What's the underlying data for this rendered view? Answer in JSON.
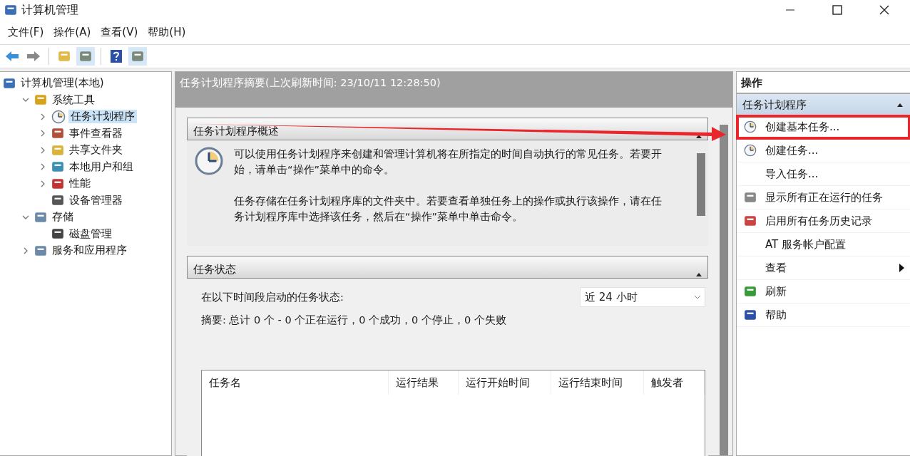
{
  "window": {
    "title": "计算机管理"
  },
  "menu": [
    "文件(F)",
    "操作(A)",
    "查看(V)",
    "帮助(H)"
  ],
  "tree": [
    {
      "label": "计算机管理(本地)",
      "selected": false,
      "children": [
        {
          "label": "系统工具",
          "selected": false,
          "expanded": true,
          "children": [
            {
              "label": "任务计划程序",
              "selected": true,
              "expanded": false
            },
            {
              "label": "事件查看器",
              "selected": false,
              "expanded": false
            },
            {
              "label": "共享文件夹",
              "selected": false,
              "expanded": false
            },
            {
              "label": "本地用户和组",
              "selected": false,
              "expanded": false
            },
            {
              "label": "性能",
              "selected": false,
              "expanded": false
            },
            {
              "label": "设备管理器",
              "selected": false
            }
          ]
        },
        {
          "label": "存储",
          "selected": false,
          "expanded": true,
          "children": [
            {
              "label": "磁盘管理",
              "selected": false
            }
          ]
        },
        {
          "label": "服务和应用程序",
          "selected": false,
          "expanded": false
        }
      ]
    }
  ],
  "summary_header": "任务计划程序摘要(上次刷新时间: 23/10/11 12:28:50)",
  "overview": {
    "title": "任务计划程序概述",
    "expanded": true,
    "paragraphs": [
      "可以使用任务计划程序来创建和管理计算机将在所指定的时间自动执行的常见任务。若要开始，请单击“操作”菜单中的命令。",
      "任务存储在任务计划程序库的文件夹中。若要查看单独任务上的操作或执行该操作，请在任务计划程序库中选择该任务，然后在“操作”菜单中单击命令。"
    ]
  },
  "task_status": {
    "title": "任务状态",
    "expanded": true,
    "period_label": "在以下时间段启动的任务状态:",
    "period": "近 24 小时",
    "summary": "摘要: 总计 0 个 - 0 个正在运行，0 个成功，0 个停止，0 个失败",
    "columns": [
      "任务名",
      "运行结果",
      "运行开始时间",
      "运行结束时间",
      "触发者"
    ]
  },
  "actions": {
    "title": "操作",
    "group": "任务计划程序",
    "group_expanded": true,
    "items": [
      {
        "label": "创建基本任务...",
        "highlighted": true,
        "submenu": false
      },
      {
        "label": "创建任务...",
        "highlighted": false,
        "submenu": false
      },
      {
        "label": "导入任务...",
        "highlighted": false,
        "submenu": false
      },
      {
        "label": "显示所有正在运行的任务",
        "highlighted": false,
        "submenu": false
      },
      {
        "label": "启用所有任务历史记录",
        "highlighted": false,
        "submenu": false
      },
      {
        "label": "AT 服务帐户配置",
        "highlighted": false,
        "submenu": false
      },
      {
        "label": "查看",
        "highlighted": false,
        "submenu": true
      },
      {
        "label": "刷新",
        "highlighted": false,
        "submenu": false
      },
      {
        "label": "帮助",
        "highlighted": false,
        "submenu": false
      }
    ]
  }
}
